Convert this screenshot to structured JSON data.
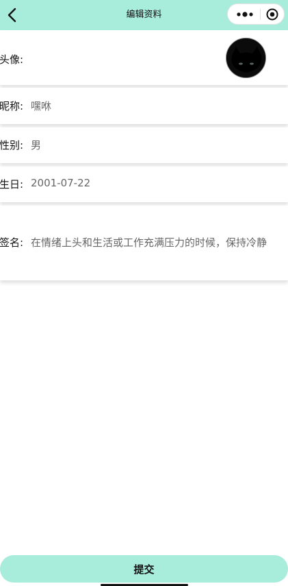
{
  "header": {
    "title": "编辑资料"
  },
  "profile": {
    "avatar_label": "头像:",
    "nickname_label": "昵称:",
    "nickname_value": "嘿咻",
    "gender_label": "性别:",
    "gender_value": "男",
    "birthday_label": "生日:",
    "birthday_value": "2001-07-22",
    "signature_label": "签名:",
    "signature_value": "在情绪上头和生活或工作充满压力的时候，保持冷静"
  },
  "footer": {
    "submit_label": "提交"
  },
  "colors": {
    "accent": "#a8ecdc",
    "value_text": "#666666"
  }
}
